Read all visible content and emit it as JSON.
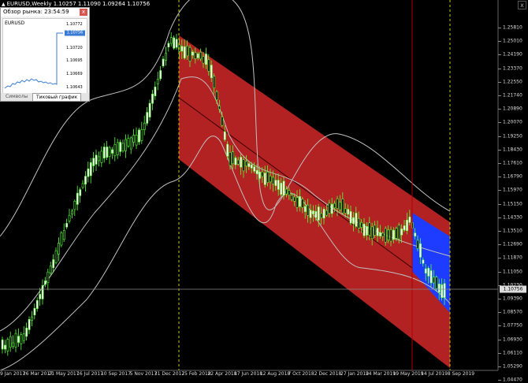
{
  "window": {
    "title": "EURUSD,Weekly  1.10257 1.11090 1.09264 1.10756",
    "close_glyph": "x"
  },
  "market_watch": {
    "title": "Обзор рынка: 23:54:59",
    "close_glyph": "x",
    "symbol": "EURUSD",
    "prices": [
      "1.10772",
      "1.10746",
      "1.10720",
      "1.10695",
      "1.10669",
      "1.10643"
    ],
    "current_price": "1.10756",
    "tabs": [
      {
        "label": "Символы",
        "active": false
      },
      {
        "label": "Тиковый график",
        "active": true
      }
    ]
  },
  "price_axis": {
    "labels": [
      "1.25810",
      "1.25010",
      "1.24190",
      "1.23370",
      "1.22550",
      "1.21740",
      "1.20890",
      "1.20070",
      "1.19250",
      "1.18430",
      "1.17610",
      "1.16790",
      "1.15970",
      "1.15150",
      "1.14330",
      "1.13510",
      "1.12690",
      "1.11870",
      "1.11050",
      "1.10230",
      "1.09390",
      "1.08570",
      "1.07750",
      "1.06930",
      "1.06110",
      "1.05290",
      "1.04470"
    ],
    "current": "1.10756"
  },
  "date_axis": {
    "labels": [
      "9 Jan 2017",
      "26 Mar 2017",
      "21 May 2017",
      "16 Jul 2017",
      "10 Sep 2017",
      "5 Nov 2017",
      "31 Dec 2017",
      "25 Feb 2018",
      "22 Apr 2018",
      "17 Jun 2018",
      "12 Aug 2018",
      "7 Oct 2018",
      "2 Dec 2018",
      "27 Jan 2019",
      "24 Mar 2019",
      "19 May 2019",
      "14 Jul 2019",
      "8 Sep 2019"
    ]
  },
  "colors": {
    "background": "#000000",
    "bull_candle": "#ffffff",
    "candle_outline": "#5aff3a",
    "channel_fill": "#b22222",
    "channel_small_fill": "#1e3cff",
    "bands": "#c0c0c0",
    "period_separator": "#c8c800",
    "vertical_marker": "#b00000"
  }
}
